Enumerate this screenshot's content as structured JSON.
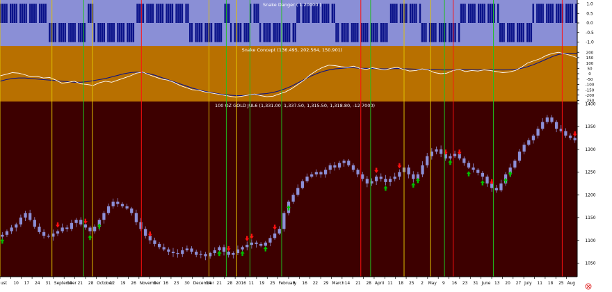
{
  "chart_data": [
    {
      "type": "bar",
      "title": "Snake Danger ( 1.20000 )",
      "ylim": [
        -1.2,
        1.2
      ],
      "yticks": [
        "1.0",
        "0.5",
        "0.0",
        "-0.5",
        "-1.0"
      ],
      "ytick_values": [
        1.0,
        0.5,
        0.0,
        -0.5,
        -1.0
      ],
      "grid": false,
      "colors": {
        "background": "#8a8fd6",
        "bars": "#0b138a"
      },
      "regimes": [
        {
          "from": 0,
          "to": 25,
          "value": 1
        },
        {
          "from": 25,
          "to": 45,
          "value": -1
        },
        {
          "from": 45,
          "to": 48,
          "value": 1
        },
        {
          "from": 48,
          "to": 70,
          "value": -1
        },
        {
          "from": 70,
          "to": 97,
          "value": 1
        },
        {
          "from": 97,
          "to": 100,
          "value": -1
        },
        {
          "from": 100,
          "to": 115,
          "value": -1
        },
        {
          "from": 115,
          "to": 118,
          "value": 1
        },
        {
          "from": 118,
          "to": 128,
          "value": -1
        },
        {
          "from": 128,
          "to": 133,
          "value": 1
        },
        {
          "from": 133,
          "to": 152,
          "value": -1
        },
        {
          "from": 152,
          "to": 172,
          "value": 1
        },
        {
          "from": 172,
          "to": 200,
          "value": -1
        },
        {
          "from": 200,
          "to": 216,
          "value": 1
        },
        {
          "from": 216,
          "to": 236,
          "value": -1
        },
        {
          "from": 236,
          "to": 256,
          "value": 1
        },
        {
          "from": 256,
          "to": 273,
          "value": -1
        },
        {
          "from": 273,
          "to": 296,
          "value": 1
        }
      ]
    },
    {
      "type": "line",
      "title": "Snake Concept (136.495, 202.564, 150.901)",
      "ylim": [
        -260,
        260
      ],
      "yticks": [
        "200",
        "150",
        "100",
        "50",
        "0",
        "-50",
        "-100",
        "-150",
        "-200",
        "-250"
      ],
      "ytick_values": [
        200,
        150,
        100,
        50,
        0,
        -50,
        -100,
        -150,
        -200,
        -250
      ],
      "grid": false,
      "colors": {
        "background": "#b87000",
        "fast": "#ffffff",
        "slow": "#0b138a"
      },
      "series": [
        {
          "values": [
            -20,
            -5,
            10,
            5,
            -10,
            -30,
            -25,
            -40,
            -35,
            -60,
            -90,
            -80,
            -70,
            -95,
            -100,
            -110,
            -85,
            -70,
            -80,
            -60,
            -40,
            -20,
            5,
            15,
            -10,
            -30,
            -50,
            -60,
            -80,
            -110,
            -130,
            -150,
            -155,
            -170,
            -180,
            -190,
            -200,
            -210,
            -220,
            -210,
            -200,
            -190,
            -205,
            -215,
            -210,
            -190,
            -170,
            -140,
            -100,
            -60,
            -10,
            30,
            60,
            80,
            75,
            65,
            60,
            70,
            50,
            40,
            55,
            45,
            35,
            50,
            60,
            40,
            25,
            30,
            45,
            35,
            10,
            0,
            5,
            30,
            40,
            20,
            30,
            25,
            35,
            30,
            20,
            10,
            15,
            30,
            60,
            100,
            120,
            140,
            170,
            190,
            200,
            185,
            170,
            150
          ]
        },
        {
          "values": [
            -70,
            -55,
            -45,
            -40,
            -40,
            -45,
            -50,
            -55,
            -60,
            -65,
            -70,
            -75,
            -80,
            -80,
            -75,
            -65,
            -55,
            -45,
            -30,
            -15,
            0,
            10,
            15,
            10,
            0,
            -15,
            -35,
            -55,
            -75,
            -95,
            -115,
            -135,
            -150,
            -165,
            -175,
            -185,
            -195,
            -200,
            -205,
            -205,
            -200,
            -195,
            -190,
            -185,
            -175,
            -160,
            -140,
            -115,
            -85,
            -55,
            -25,
            0,
            20,
            35,
            45,
            50,
            55,
            55,
            50,
            50,
            48,
            46,
            45,
            46,
            48,
            46,
            44,
            42,
            42,
            40,
            38,
            36,
            35,
            36,
            38,
            38,
            36,
            35,
            35,
            36,
            36,
            35,
            36,
            40,
            50,
            65,
            85,
            110,
            135,
            160,
            180,
            190,
            192,
            190
          ]
        }
      ]
    },
    {
      "type": "candlestick",
      "title": "100 OZ GOLD JUL6 (1,331.00, 1,337.50, 1,315.50, 1,318.80, -12.7000)",
      "ylim": [
        1020,
        1405
      ],
      "yticks": [
        "1400",
        "1350",
        "1300",
        "1250",
        "1200",
        "1150",
        "1100",
        "1050"
      ],
      "ytick_values": [
        1400,
        1350,
        1300,
        1250,
        1200,
        1150,
        1100,
        1050
      ],
      "grid": false,
      "colors": {
        "background": "#3d0000",
        "candle": "#8c8fd6",
        "buy_arrow": "#00c000",
        "sell_arrow": "#ff1010"
      },
      "close": [
        1112,
        1120,
        1128,
        1135,
        1150,
        1160,
        1145,
        1130,
        1118,
        1110,
        1108,
        1115,
        1120,
        1128,
        1125,
        1138,
        1145,
        1135,
        1128,
        1120,
        1130,
        1145,
        1160,
        1175,
        1185,
        1180,
        1175,
        1170,
        1160,
        1140,
        1125,
        1110,
        1100,
        1092,
        1085,
        1080,
        1075,
        1072,
        1070,
        1078,
        1082,
        1075,
        1068,
        1070,
        1065,
        1072,
        1078,
        1085,
        1075,
        1068,
        1072,
        1080,
        1085,
        1090,
        1095,
        1092,
        1088,
        1095,
        1105,
        1115,
        1125,
        1160,
        1185,
        1200,
        1215,
        1230,
        1240,
        1245,
        1250,
        1245,
        1255,
        1265,
        1260,
        1270,
        1275,
        1265,
        1255,
        1245,
        1235,
        1225,
        1230,
        1240,
        1235,
        1228,
        1235,
        1240,
        1250,
        1260,
        1245,
        1235,
        1245,
        1265,
        1285,
        1295,
        1300,
        1290,
        1280,
        1285,
        1290,
        1280,
        1270,
        1260,
        1255,
        1248,
        1240,
        1225,
        1215,
        1210,
        1225,
        1245,
        1260,
        1275,
        1295,
        1310,
        1320,
        1330,
        1345,
        1360,
        1370,
        1360,
        1345,
        1340,
        1330,
        1325,
        1320
      ],
      "markers": [
        {
          "i": 0,
          "kind": "buy"
        },
        {
          "i": 14,
          "kind": "sell"
        },
        {
          "i": 21,
          "kind": "sell"
        },
        {
          "i": 22,
          "kind": "buy"
        },
        {
          "i": 24,
          "kind": "buy"
        },
        {
          "i": 37,
          "kind": "sell"
        },
        {
          "i": 54,
          "kind": "buy"
        },
        {
          "i": 55,
          "kind": "buy"
        },
        {
          "i": 57,
          "kind": "sell"
        },
        {
          "i": 60,
          "kind": "buy"
        },
        {
          "i": 62,
          "kind": "sell"
        },
        {
          "i": 63,
          "kind": "sell"
        },
        {
          "i": 66,
          "kind": "buy"
        },
        {
          "i": 68,
          "kind": "sell"
        },
        {
          "i": 72,
          "kind": "buy"
        },
        {
          "i": 94,
          "kind": "sell"
        },
        {
          "i": 96,
          "kind": "buy"
        },
        {
          "i": 100,
          "kind": "sell"
        },
        {
          "i": 103,
          "kind": "buy"
        },
        {
          "i": 105,
          "kind": "buy"
        },
        {
          "i": 112,
          "kind": "sell"
        },
        {
          "i": 113,
          "kind": "buy"
        },
        {
          "i": 115,
          "kind": "sell"
        },
        {
          "i": 117,
          "kind": "buy"
        },
        {
          "i": 121,
          "kind": "buy"
        },
        {
          "i": 123,
          "kind": "sell"
        },
        {
          "i": 126,
          "kind": "buy"
        },
        {
          "i": 128,
          "kind": "buy"
        },
        {
          "i": 144,
          "kind": "sell"
        }
      ]
    }
  ],
  "x_axis": {
    "ticks": [
      "ust",
      "10",
      "17",
      "24",
      "31",
      "September",
      "14",
      "21",
      "28",
      "October",
      "12",
      "19",
      "26",
      "November",
      "9",
      "16",
      "23",
      "30",
      "December",
      "14",
      "21",
      "28",
      "2016",
      "11",
      "19",
      "25",
      "February",
      "8",
      "16",
      "22",
      "29",
      "March",
      "14",
      "21",
      "28",
      "April",
      "11",
      "18",
      "25",
      "2",
      "May",
      "9",
      "16",
      "23",
      "31",
      "June",
      "13",
      "20",
      "27",
      "July",
      "11",
      "18",
      "25",
      "Aug"
    ],
    "month_labels": [
      "ust",
      "September",
      "October",
      "November",
      "December",
      "2016",
      "February",
      "March",
      "April",
      "May",
      "June",
      "July",
      "Aug"
    ]
  },
  "signal_lines": [
    {
      "at": 0.0,
      "color": "yellow"
    },
    {
      "at": 0.09,
      "color": "yellow"
    },
    {
      "at": 0.145,
      "color": "green"
    },
    {
      "at": 0.16,
      "color": "yellow"
    },
    {
      "at": 0.245,
      "color": "red"
    },
    {
      "at": 0.362,
      "color": "yellow"
    },
    {
      "at": 0.392,
      "color": "green"
    },
    {
      "at": 0.41,
      "color": "yellow"
    },
    {
      "at": 0.433,
      "color": "green"
    },
    {
      "at": 0.488,
      "color": "green"
    },
    {
      "at": 0.625,
      "color": "red"
    },
    {
      "at": 0.642,
      "color": "green"
    },
    {
      "at": 0.7,
      "color": "yellow"
    },
    {
      "at": 0.746,
      "color": "yellow"
    },
    {
      "at": 0.77,
      "color": "green"
    },
    {
      "at": 0.785,
      "color": "red"
    },
    {
      "at": 0.855,
      "color": "green"
    },
    {
      "at": 0.974,
      "color": "red"
    }
  ],
  "close_icon": "close-circle-icon"
}
